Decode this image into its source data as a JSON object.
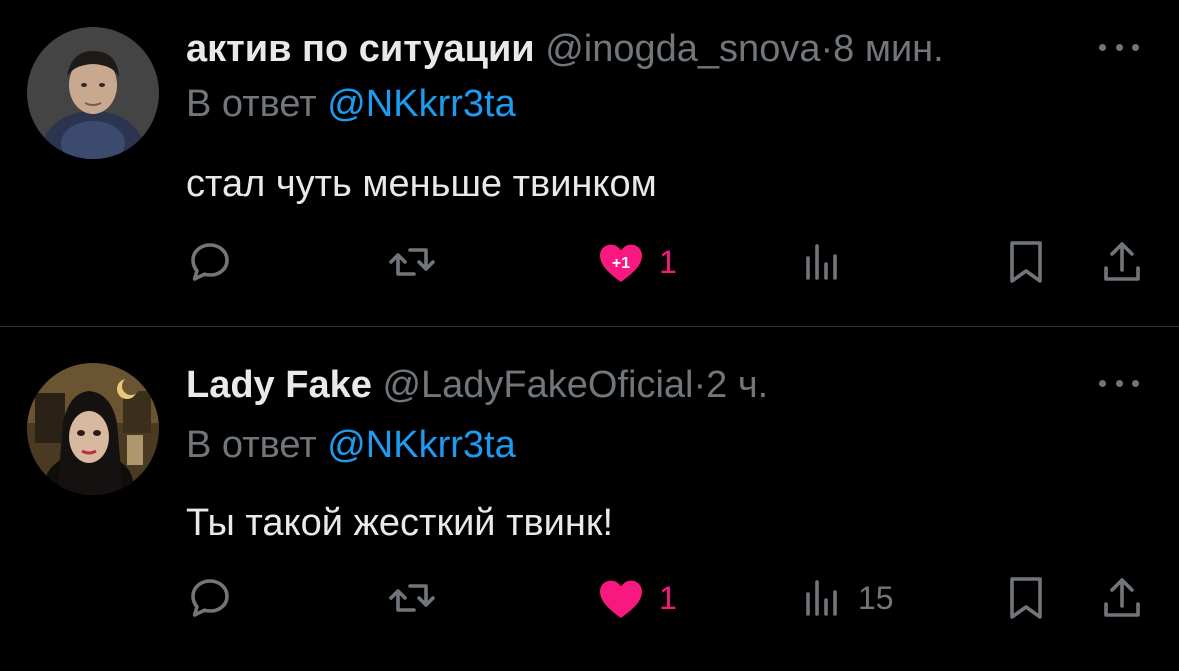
{
  "colors": {
    "background": "#000000",
    "text": "#e7e9ea",
    "muted": "#71767b",
    "mention": "#1d9bf0",
    "like": "#f91880",
    "divider": "#2f3336"
  },
  "tweets": [
    {
      "display_name": "актив по ситуации",
      "handle": "@inogda_snova",
      "separator": "·",
      "time": "8 мин.",
      "reply_prefix": "В ответ",
      "reply_mention": "@NKkrr3ta",
      "text": "стал чуть меньше твинком",
      "like_badge": "+1",
      "like_count": "1",
      "view_count": "",
      "liked": true,
      "icons": [
        "reply-icon",
        "retweet-icon",
        "like-icon",
        "views-icon",
        "bookmark-icon",
        "share-icon",
        "more-icon"
      ]
    },
    {
      "display_name": "Lady Fake",
      "handle": "@LadyFakeOficial",
      "separator": "·",
      "time": "2 ч.",
      "reply_prefix": "В ответ",
      "reply_mention": "@NKkrr3ta",
      "text": "Ты такой жесткий твинк!",
      "like_count": "1",
      "view_count": "15",
      "liked": true,
      "icons": [
        "reply-icon",
        "retweet-icon",
        "like-icon",
        "views-icon",
        "bookmark-icon",
        "share-icon",
        "more-icon"
      ]
    }
  ]
}
